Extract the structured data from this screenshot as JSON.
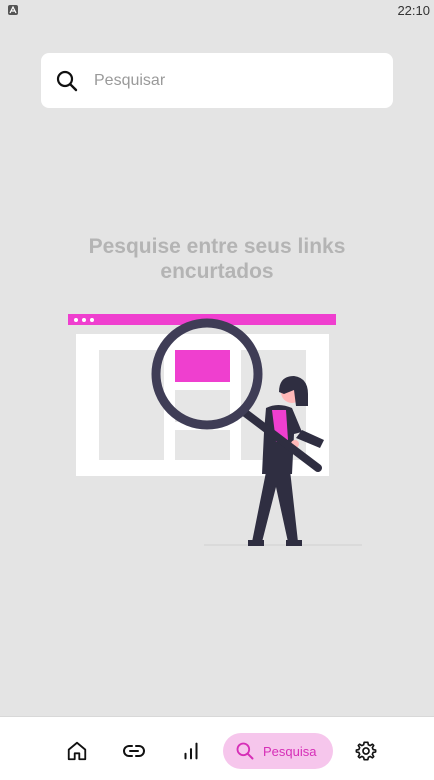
{
  "status_bar": {
    "time": "22:10",
    "app_icon": "android-a-icon"
  },
  "search": {
    "placeholder": "Pesquisar",
    "value": ""
  },
  "empty_state": {
    "title": "Pesquise entre seus links encurtados",
    "illustration": "woman-with-magnifying-glass-illustration"
  },
  "bottom_nav": {
    "items": [
      {
        "icon": "home-icon"
      },
      {
        "icon": "link-icon"
      },
      {
        "icon": "bar-chart-icon"
      },
      {
        "icon": "search-icon",
        "label": "Pesquisa",
        "active": true
      },
      {
        "icon": "gear-icon"
      }
    ]
  },
  "colors": {
    "accent": "#ef3fcf",
    "accent_soft": "#f6c6ec",
    "background": "#e4e4e4",
    "dark": "#2f2e41"
  }
}
